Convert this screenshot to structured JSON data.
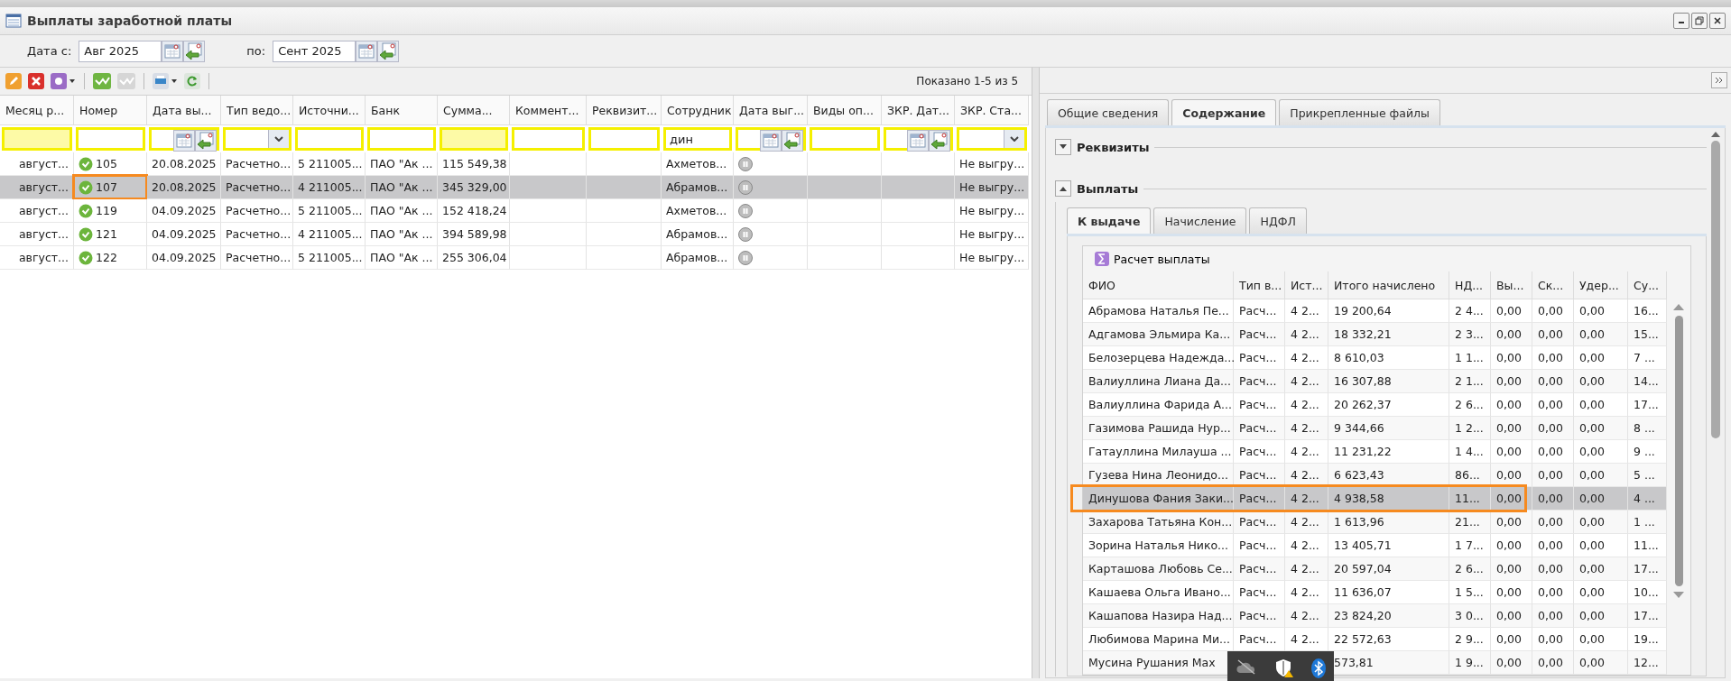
{
  "window": {
    "title": "Выплаты заработной платы"
  },
  "date_filter": {
    "from_label": "Дата с:",
    "from_value": "Авг 2025",
    "to_label": "по:",
    "to_value": "Сент 2025"
  },
  "toolbar": {
    "summary": "Показано 1-5 из 5"
  },
  "grid": {
    "columns": [
      "Месяц р...",
      "Номер",
      "Дата вы...",
      "Тип ведо...",
      "Источни...",
      "Банк",
      "Сумма...",
      "Коммент...",
      "Реквизит...",
      "Сотрудник",
      "Дата выг...",
      "Виды оп...",
      "ЗКР. Дат...",
      "ЗКР. Ста..."
    ],
    "filters": [
      {
        "kind": "plain"
      },
      {
        "kind": "text"
      },
      {
        "kind": "date"
      },
      {
        "kind": "combo"
      },
      {
        "kind": "text"
      },
      {
        "kind": "text"
      },
      {
        "kind": "plain"
      },
      {
        "kind": "text"
      },
      {
        "kind": "text"
      },
      {
        "kind": "text",
        "value": "дин"
      },
      {
        "kind": "date"
      },
      {
        "kind": "text"
      },
      {
        "kind": "date"
      },
      {
        "kind": "combo"
      }
    ],
    "rows": [
      {
        "selected": false,
        "marked": false,
        "cells": [
          "август...",
          "105",
          "20.08.2025",
          "Расчетно...",
          "5 211005...",
          "ПАО \"Ак ...",
          "115 549,38",
          null,
          null,
          "Ахметов...",
          null,
          null,
          null,
          "Не выгру..."
        ]
      },
      {
        "selected": true,
        "marked": true,
        "cells": [
          "август...",
          "107",
          "20.08.2025",
          "Расчетно...",
          "4 211005...",
          "ПАО \"Ак ...",
          "345 329,00",
          null,
          null,
          "Абрамов...",
          null,
          null,
          null,
          "Не выгру..."
        ]
      },
      {
        "selected": false,
        "marked": false,
        "cells": [
          "август...",
          "119",
          "04.09.2025",
          "Расчетно...",
          "5 211005...",
          "ПАО \"Ак ...",
          "152 418,24",
          null,
          null,
          "Ахметов...",
          null,
          null,
          null,
          "Не выгру..."
        ]
      },
      {
        "selected": false,
        "marked": false,
        "cells": [
          "август...",
          "121",
          "04.09.2025",
          "Расчетно...",
          "4 211005...",
          "ПАО \"Ак ...",
          "394 589,98",
          null,
          null,
          "Абрамов...",
          null,
          null,
          null,
          "Не выгру..."
        ]
      },
      {
        "selected": false,
        "marked": false,
        "cells": [
          "август...",
          "122",
          "04.09.2025",
          "Расчетно...",
          "5 211005...",
          "ПАО \"Ак ...",
          "255 306,04",
          null,
          null,
          "Абрамов...",
          null,
          null,
          null,
          "Не выгру..."
        ]
      }
    ]
  },
  "detail": {
    "tabs": [
      {
        "label": "Общие сведения",
        "selected": false
      },
      {
        "label": "Содержание",
        "selected": true
      },
      {
        "label": "Прикрепленные файлы",
        "selected": false
      }
    ],
    "sections": [
      {
        "title": "Реквизиты",
        "expanded": false
      },
      {
        "title": "Выплаты",
        "expanded": true
      }
    ],
    "payment_tabs": [
      {
        "label": "К выдаче",
        "selected": true
      },
      {
        "label": "Начисление",
        "selected": false
      },
      {
        "label": "НДФЛ",
        "selected": false
      }
    ],
    "action": "Расчет выплаты",
    "columns": [
      "ФИО",
      "Тип в...",
      "Ист...",
      "Итого начислено",
      "НД...",
      "Вы...",
      "Ск...",
      "Удер...",
      "Су..."
    ],
    "rows": [
      {
        "selected": false,
        "marked": false,
        "cells": [
          "Абрамова Наталья Пе...",
          "Расч...",
          "4 2...",
          "19 200,64",
          "2 4...",
          "0,00",
          "0,00",
          "0,00",
          "16..."
        ]
      },
      {
        "selected": false,
        "marked": false,
        "cells": [
          "Адгамова Эльмира Ка...",
          "Расч...",
          "4 2...",
          "18 332,21",
          "2 3...",
          "0,00",
          "0,00",
          "0,00",
          "15..."
        ]
      },
      {
        "selected": false,
        "marked": false,
        "cells": [
          "Белозерцева Надежда...",
          "Расч...",
          "4 2...",
          "8 610,03",
          "1 1...",
          "0,00",
          "0,00",
          "0,00",
          "7 ..."
        ]
      },
      {
        "selected": false,
        "marked": false,
        "cells": [
          "Валиуллина Лиана Да...",
          "Расч...",
          "4 2...",
          "16 307,88",
          "2 1...",
          "0,00",
          "0,00",
          "0,00",
          "14..."
        ]
      },
      {
        "selected": false,
        "marked": false,
        "cells": [
          "Валиуллина Фарида А...",
          "Расч...",
          "4 2...",
          "20 262,37",
          "2 6...",
          "0,00",
          "0,00",
          "0,00",
          "17..."
        ]
      },
      {
        "selected": false,
        "marked": false,
        "cells": [
          "Газимова Рашида Нур...",
          "Расч...",
          "4 2...",
          "9 344,66",
          "1 2...",
          "0,00",
          "0,00",
          "0,00",
          "8 ..."
        ]
      },
      {
        "selected": false,
        "marked": false,
        "cells": [
          "Гатауллина Милауша ...",
          "Расч...",
          "4 2...",
          "11 231,22",
          "1 4...",
          "0,00",
          "0,00",
          "0,00",
          "9 ..."
        ]
      },
      {
        "selected": false,
        "marked": false,
        "cells": [
          "Гузева Нина Леонидо...",
          "Расч...",
          "4 2...",
          "6 623,43",
          "86...",
          "0,00",
          "0,00",
          "0,00",
          "5 ..."
        ]
      },
      {
        "selected": true,
        "marked": true,
        "cells": [
          "Динушова Фания Заки...",
          "Расч...",
          "4 2...",
          "4 938,58",
          "11...",
          "0,00",
          "0,00",
          "0,00",
          "4 ..."
        ]
      },
      {
        "selected": false,
        "marked": false,
        "cells": [
          "Захарова Татьяна Кон...",
          "Расч...",
          "4 2...",
          "1 613,96",
          "21...",
          "0,00",
          "0,00",
          "0,00",
          "1 ..."
        ]
      },
      {
        "selected": false,
        "marked": false,
        "cells": [
          "Зорина Наталья Нико...",
          "Расч...",
          "4 2...",
          "13 405,71",
          "1 7...",
          "0,00",
          "0,00",
          "0,00",
          "11..."
        ]
      },
      {
        "selected": false,
        "marked": false,
        "cells": [
          "Карташова Любовь Се...",
          "Расч...",
          "4 2...",
          "20 597,04",
          "2 6...",
          "0,00",
          "0,00",
          "0,00",
          "17..."
        ]
      },
      {
        "selected": false,
        "marked": false,
        "cells": [
          "Кашаева Ольга Ивано...",
          "Расч...",
          "4 2...",
          "11 636,07",
          "1 5...",
          "0,00",
          "0,00",
          "0,00",
          "10..."
        ]
      },
      {
        "selected": false,
        "marked": false,
        "cells": [
          "Кашапова Назира Над...",
          "Расч...",
          "4 2...",
          "23 824,20",
          "3 0...",
          "0,00",
          "0,00",
          "0,00",
          "17..."
        ]
      },
      {
        "selected": false,
        "marked": false,
        "cells": [
          "Любимова Марина Ми...",
          "Расч...",
          "4 2...",
          "22 572,63",
          "2 9...",
          "0,00",
          "0,00",
          "0,00",
          "19..."
        ]
      },
      {
        "selected": false,
        "marked": false,
        "cells": [
          "Мусина Рушания Мах",
          null,
          null,
          "573,81",
          "1 9...",
          "0,00",
          "0,00",
          "0,00",
          "12..."
        ]
      }
    ]
  }
}
